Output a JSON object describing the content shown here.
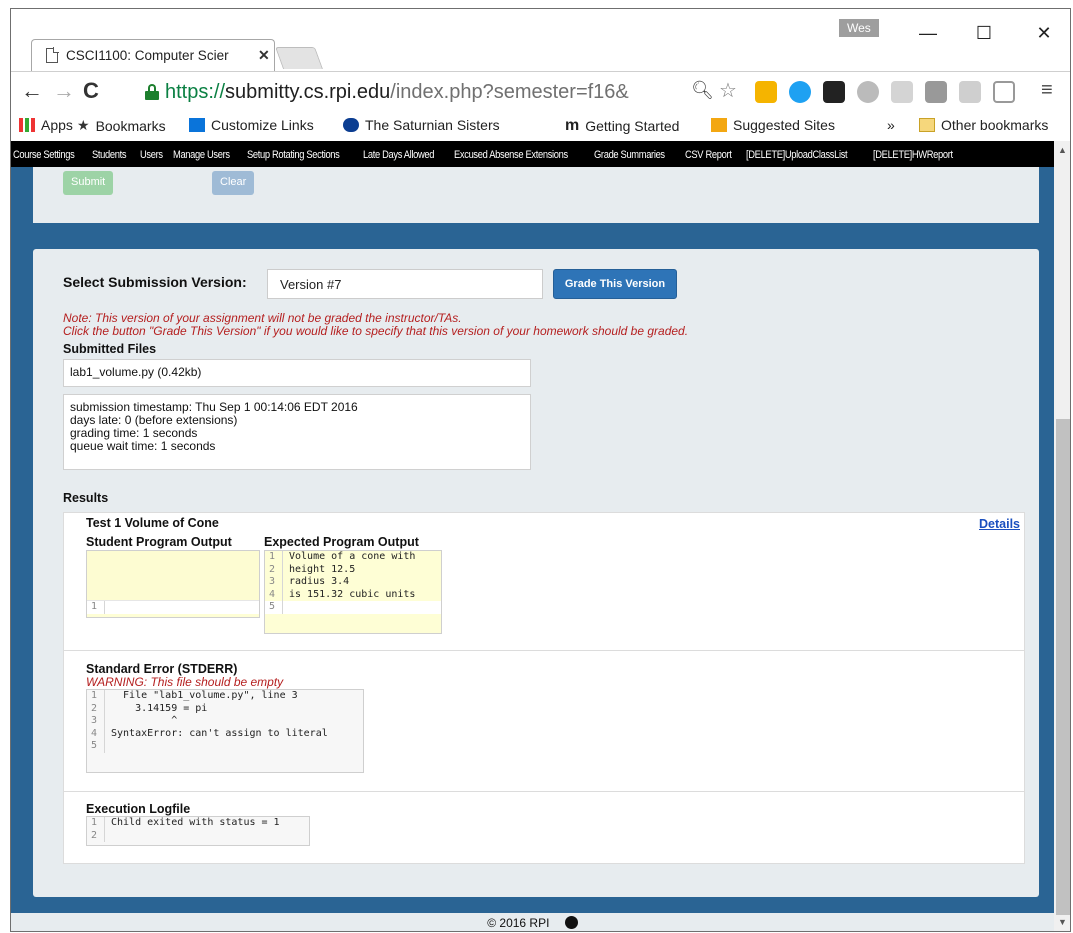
{
  "browser": {
    "tab_title": "CSCI1100: Computer Scier",
    "tab_close": "✕",
    "user_badge": "Wes",
    "window_controls": {
      "minimize": "—",
      "maximize": "☐",
      "close": "✕"
    },
    "url_scheme": "https://",
    "url_host": "submitty.cs.rpi.edu",
    "url_path": "/index.php?semester=f16&",
    "bookmarks": [
      {
        "label": "Apps",
        "icon": "apps-grid-icon"
      },
      {
        "label": "Bookmarks",
        "icon": "star-icon"
      },
      {
        "label": "Customize Links",
        "icon": "windows-icon"
      },
      {
        "label": "The Saturnian Sisters",
        "icon": "nasa-icon"
      },
      {
        "label": "Getting Started",
        "icon": "m-logo-icon"
      },
      {
        "label": "Suggested Sites",
        "icon": "bing-icon"
      }
    ],
    "bookmarks_more": "»",
    "other_bookmarks": "Other bookmarks",
    "colors": {
      "secure_green": "#0b8043",
      "page_blue": "#2a6494",
      "button_blue": "#2e74b7",
      "warning_red": "#b52020"
    }
  },
  "nav": {
    "items": [
      "Course Settings",
      "Students",
      "Users",
      "Manage Users",
      "Setup Rotating Sections",
      "Late Days Allowed",
      "Excused Absense Extensions",
      "Grade Summaries",
      "CSV Report",
      "[DELETE]UploadClassList",
      "[DELETE]HWReport"
    ]
  },
  "top_panel": {
    "submit_label": "Submit",
    "clear_label": "Clear"
  },
  "submission": {
    "select_label": "Select Submission Version:",
    "version_value": "Version #7",
    "grade_button": "Grade This Version",
    "note_line1": "Note: This version of your assignment will not be graded the instructor/TAs.",
    "note_line2": "Click the button \"Grade This Version\" if you would like to specify that this version of your homework should be graded.",
    "submitted_files_title": "Submitted Files",
    "file": "lab1_volume.py (0.42kb)",
    "details": [
      "submission timestamp: Thu Sep 1 00:14:06 EDT 2016",
      "days late: 0 (before extensions)",
      "grading time: 1 seconds",
      "queue wait time: 1 seconds"
    ]
  },
  "results": {
    "title": "Results",
    "test_title": "Test 1 Volume of Cone",
    "details_link": "Details",
    "student_output_title": "Student Program Output",
    "student_output_lines": [
      {
        "n": "1",
        "t": ""
      }
    ],
    "expected_output_title": "Expected Program Output",
    "expected_output_lines": [
      {
        "n": "1",
        "t": "Volume of a cone with"
      },
      {
        "n": "2",
        "t": "height 12.5"
      },
      {
        "n": "3",
        "t": "radius 3.4"
      },
      {
        "n": "4",
        "t": "is 151.32 cubic units"
      },
      {
        "n": "5",
        "t": ""
      }
    ],
    "stderr_title": "Standard Error (STDERR)",
    "stderr_warning": "WARNING: This file should be empty",
    "stderr_lines": [
      {
        "n": "1",
        "t": "  File \"lab1_volume.py\", line 3"
      },
      {
        "n": "2",
        "t": "    3.14159 = pi"
      },
      {
        "n": "3",
        "t": "          ^"
      },
      {
        "n": "4",
        "t": "SyntaxError: can't assign to literal"
      },
      {
        "n": "5",
        "t": ""
      }
    ],
    "logfile_title": "Execution Logfile",
    "logfile_lines": [
      {
        "n": "1",
        "t": "Child exited with status = 1"
      },
      {
        "n": "2",
        "t": ""
      }
    ]
  },
  "footer": {
    "text": "© 2016 RPI",
    "icon": "github-icon"
  }
}
